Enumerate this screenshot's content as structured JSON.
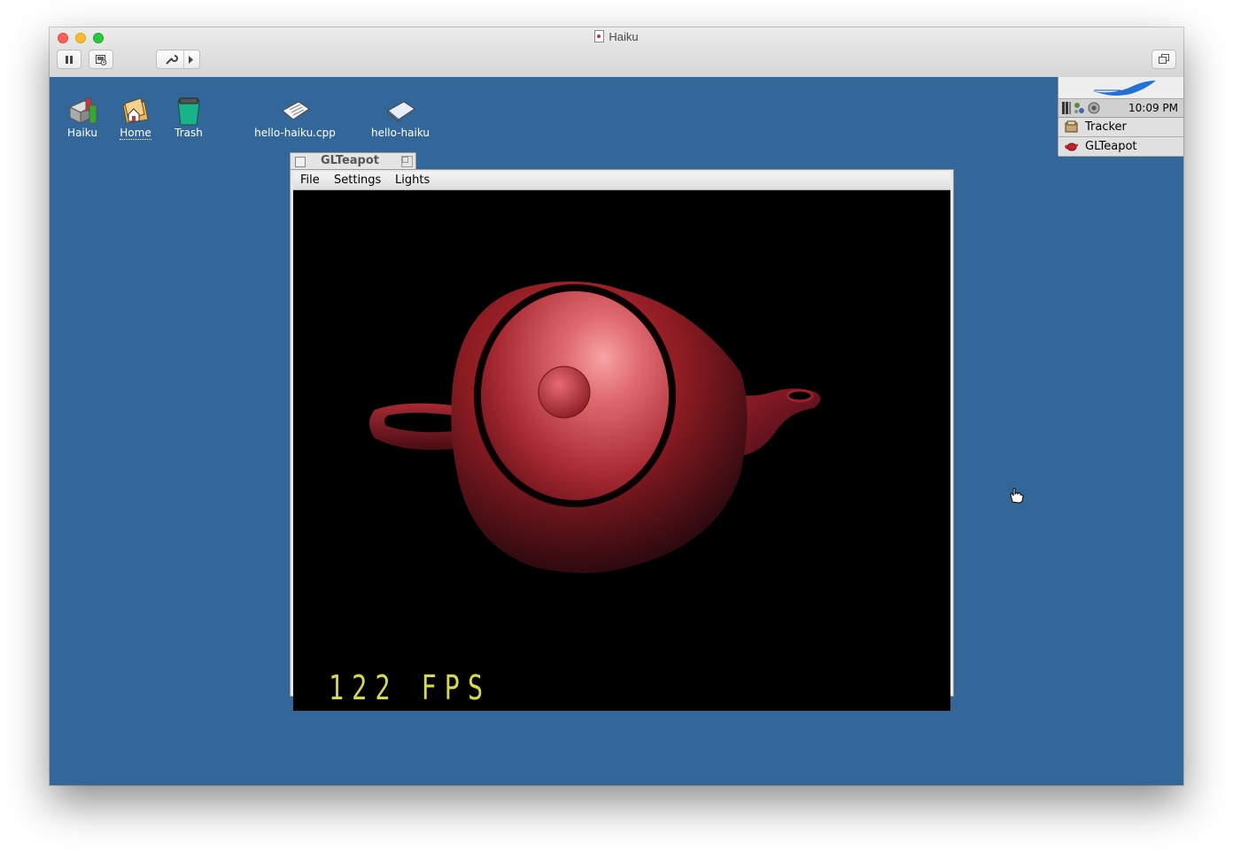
{
  "vm": {
    "title": "Haiku"
  },
  "desktop": {
    "icons": [
      {
        "label": "Haiku"
      },
      {
        "label": "Home"
      },
      {
        "label": "Trash"
      },
      {
        "label": "hello-haiku.cpp"
      },
      {
        "label": "hello-haiku"
      }
    ]
  },
  "deskbar": {
    "clock": "10:09 PM",
    "apps": [
      {
        "label": "Tracker"
      },
      {
        "label": "GLTeapot"
      }
    ]
  },
  "teapot_window": {
    "title": "GLTeapot",
    "menu": [
      {
        "label": "File"
      },
      {
        "label": "Settings"
      },
      {
        "label": "Lights"
      }
    ],
    "fps": "122 FPS"
  },
  "colors": {
    "desktop": "#336699",
    "teapot": "#b3262c",
    "fps_text": "#d7d750"
  }
}
